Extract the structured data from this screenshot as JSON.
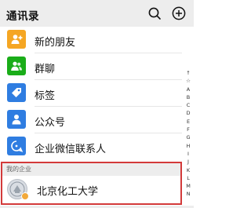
{
  "header": {
    "title": "通讯录",
    "icons": [
      "search-icon",
      "add-icon"
    ]
  },
  "list": {
    "items": [
      {
        "label": "新的朋友",
        "icon": "add-friend-icon",
        "color": "#f5a623"
      },
      {
        "label": "群聊",
        "icon": "group-chat-icon",
        "color": "#1aad19"
      },
      {
        "label": "标签",
        "icon": "tag-icon",
        "color": "#2f7de1"
      },
      {
        "label": "公众号",
        "icon": "official-account-icon",
        "color": "#2f7de1"
      },
      {
        "label": "企业微信联系人",
        "icon": "work-contact-icon",
        "color": "#2f7de1"
      }
    ]
  },
  "enterprise": {
    "section_label": "我的企业",
    "name": "北京化工大学",
    "logo_icon": "university-logo-icon",
    "highlight_color": "#d33a3a"
  },
  "index": {
    "letters": [
      "↑",
      "☆",
      "A",
      "B",
      "C",
      "D",
      "E",
      "F",
      "G",
      "H",
      "I",
      "J",
      "K",
      "L",
      "M",
      "N"
    ]
  }
}
